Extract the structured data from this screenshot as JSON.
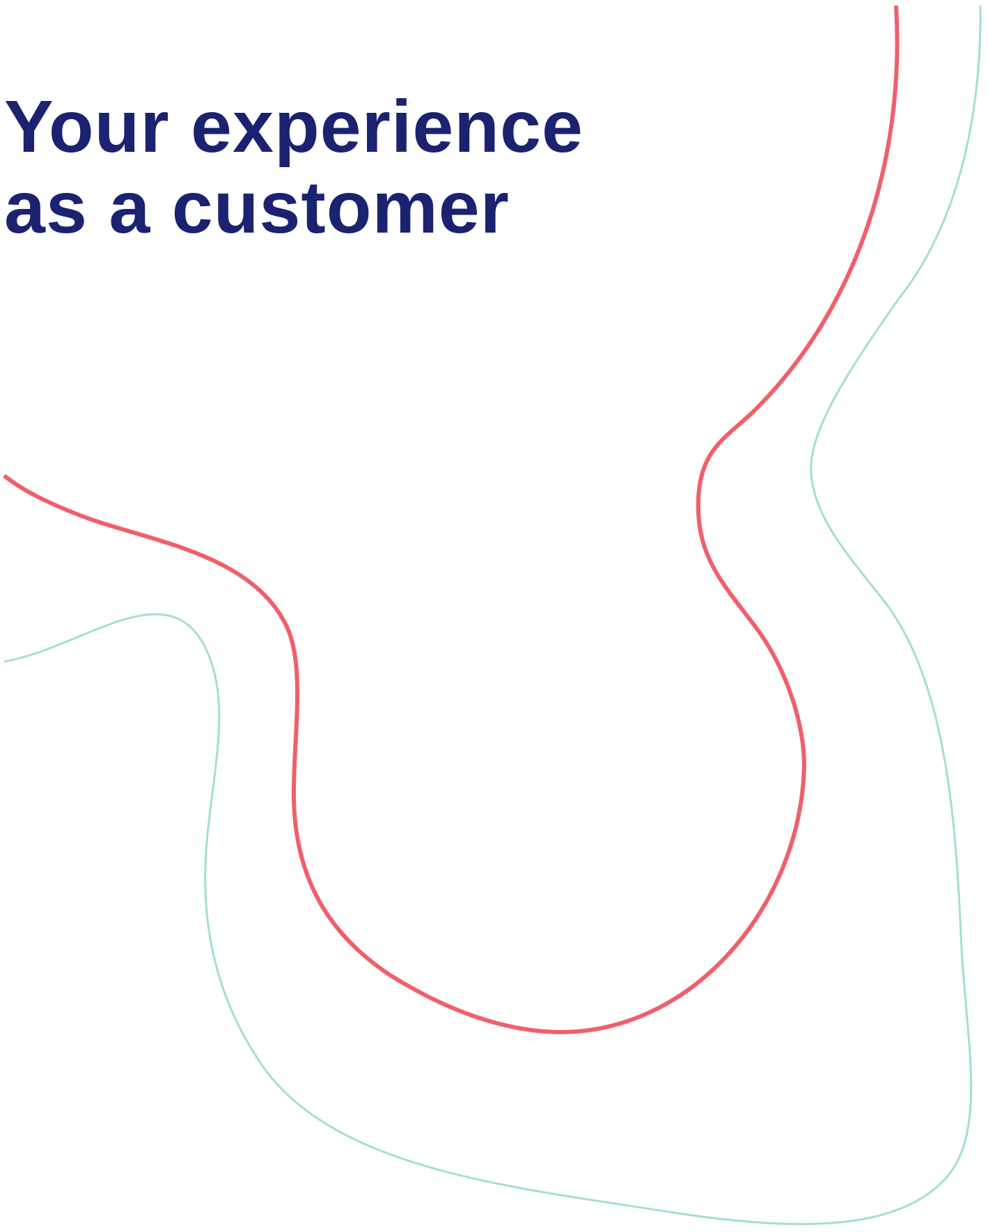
{
  "heading": {
    "line1": "Your experience",
    "line2": "as a customer"
  },
  "colors": {
    "heading_text": "#1b2270",
    "coral_line": "#f0606a",
    "mint_line": "#a6ddd4",
    "background": "#ffffff"
  },
  "decorations": {
    "coral_curve": "coral-curve",
    "mint_curve": "mint-curve"
  }
}
